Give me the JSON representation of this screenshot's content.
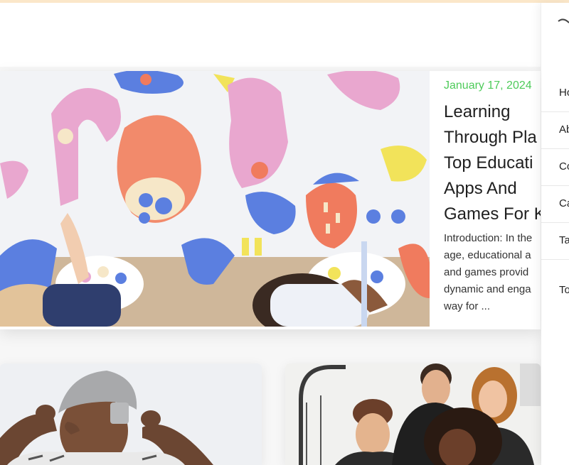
{
  "featured_post": {
    "date": "January 17, 2024",
    "title_lines": [
      "Learning",
      "Through Pla",
      "Top Educati",
      "Apps And",
      "Games For K"
    ],
    "excerpt_lines": [
      "Introduction: In the",
      "age, educational a",
      "and games provid",
      "dynamic and enga",
      "way for ..."
    ]
  },
  "sidebar": {
    "items": [
      {
        "label": "Ho"
      },
      {
        "label": "Ab"
      },
      {
        "label": "Co"
      },
      {
        "label": "Ca"
      },
      {
        "label": "Ta"
      },
      {
        "label": "To"
      }
    ]
  },
  "colors": {
    "date_accent": "#4ecb5a",
    "top_border": "#fbe7c9",
    "page_bg": "#f7f7f7"
  }
}
